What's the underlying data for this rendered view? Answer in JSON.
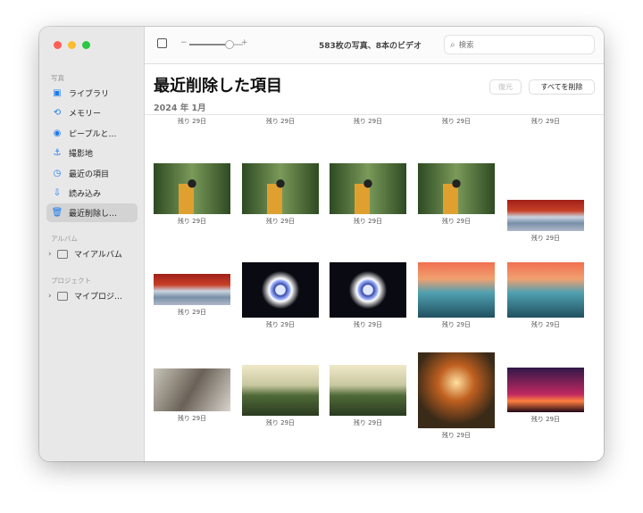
{
  "toolbar": {
    "count": "583枚の写真、8本のビデオ",
    "search_placeholder": "検索",
    "zoom_minus": "−",
    "zoom_plus": "+",
    "zoom_level": 0.75
  },
  "sidebar": {
    "section_photos": "写真",
    "items": [
      {
        "label": "ライブラリ",
        "icon": "library-icon"
      },
      {
        "label": "メモリー",
        "icon": "memories-icon"
      },
      {
        "label": "ピープルと…",
        "icon": "people-icon"
      },
      {
        "label": "撮影地",
        "icon": "places-icon"
      },
      {
        "label": "最近の項目",
        "icon": "recents-icon"
      },
      {
        "label": "読み込み",
        "icon": "imports-icon"
      },
      {
        "label": "最近削除し…",
        "icon": "trash-icon"
      }
    ],
    "section_albums": "アルバム",
    "my_albums": "マイアルバム",
    "section_projects": "プロジェクト",
    "my_projects": "マイプロジ…"
  },
  "main": {
    "title": "最近削除した項目",
    "date": "2024 年 1月",
    "restore": "復元",
    "delete_all": "すべてを削除"
  },
  "photos": [
    {
      "label": "残り 29日"
    },
    {
      "label": "残り 29日"
    },
    {
      "label": "残り 29日"
    },
    {
      "label": "残り 29日"
    },
    {
      "label": "残り 29日"
    },
    {
      "label": "残り 29日",
      "kind": "camera"
    },
    {
      "label": "残り 29日",
      "kind": "camera"
    },
    {
      "label": "残り 29日",
      "kind": "camera"
    },
    {
      "label": "残り 29日",
      "kind": "camera"
    },
    {
      "label": "残り 29日",
      "kind": "fuji"
    },
    {
      "label": "残り 29日",
      "kind": "fuji"
    },
    {
      "label": "残り 29日",
      "kind": "rings"
    },
    {
      "label": "残り 29日",
      "kind": "rings"
    },
    {
      "label": "残り 29日",
      "kind": "mountains"
    },
    {
      "label": "残り 29日",
      "kind": "mountains"
    },
    {
      "label": "残り 29日",
      "kind": "smoke"
    },
    {
      "label": "残り 29日",
      "kind": "grass"
    },
    {
      "label": "残り 29日",
      "kind": "grass"
    },
    {
      "label": "残り 29日",
      "kind": "fox"
    },
    {
      "label": "残り 29日",
      "kind": "tree"
    }
  ]
}
